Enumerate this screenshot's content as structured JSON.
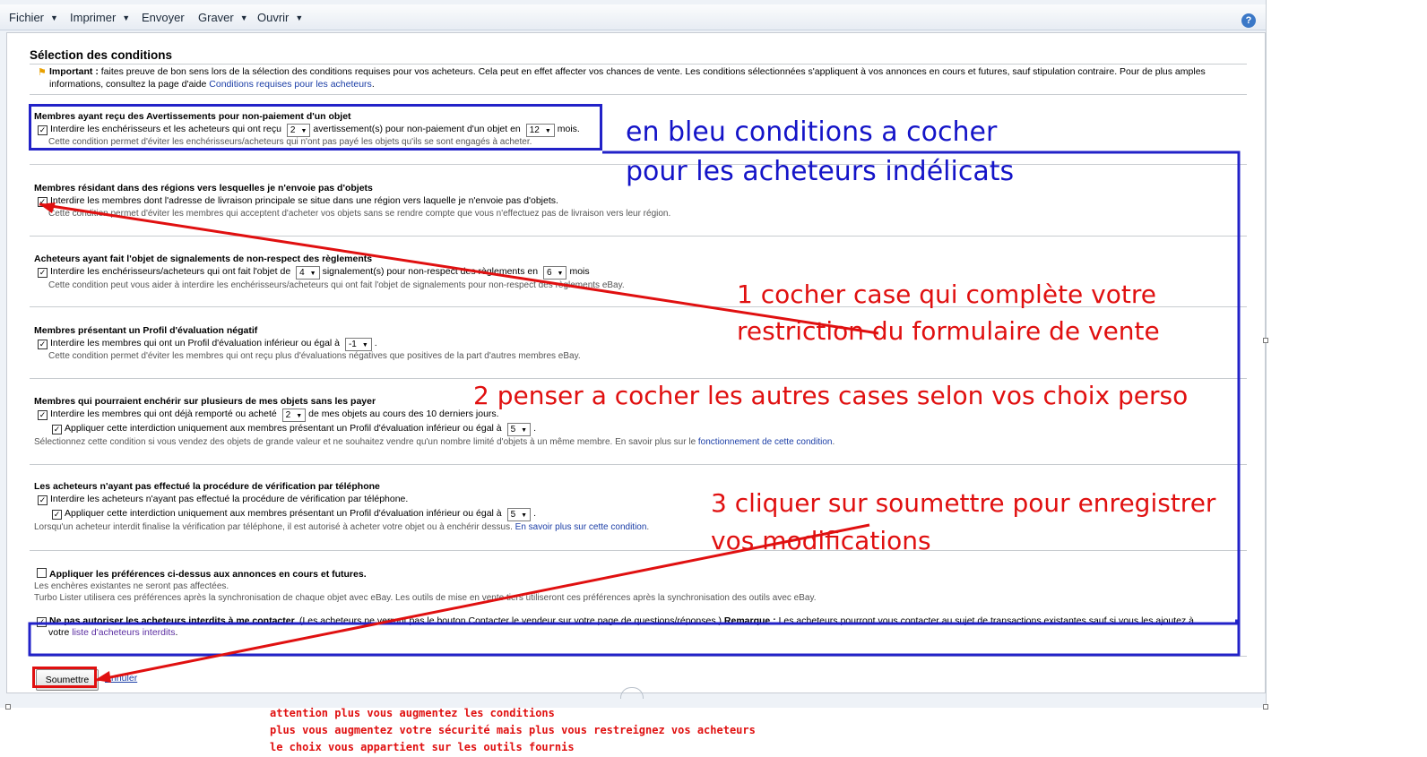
{
  "menu": [
    {
      "label": "Fichier",
      "has_dropdown": true
    },
    {
      "label": "Imprimer",
      "has_dropdown": true
    },
    {
      "label": "Envoyer",
      "has_dropdown": false
    },
    {
      "label": "Graver",
      "has_dropdown": true
    },
    {
      "label": "Ouvrir",
      "has_dropdown": true
    }
  ],
  "page": {
    "title": "Sélection des conditions",
    "important_bold": "Important :",
    "important_text": " faites preuve de bon sens lors de la sélection des conditions requises pour vos acheteurs. Cela peut en effet affecter vos chances de vente. Les conditions sélectionnées s'appliquent à vos annonces en cours et futures, sauf stipulation contraire. Pour de plus amples informations, consultez la page d'aide ",
    "important_link": "Conditions requises pour les acheteurs",
    "important_end": "."
  },
  "sections": {
    "s1": {
      "title": "Membres ayant reçu des Avertissements pour non-paiement d'un objet",
      "row_a": "Interdire les enchérisseurs et les acheteurs qui ont reçu",
      "select1": "2",
      "row_b": "avertissement(s) pour non-paiement d'un objet en",
      "select2": "12",
      "row_c": "mois.",
      "desc": "Cette condition permet d'éviter les enchérisseurs/acheteurs qui n'ont pas payé les objets qu'ils se sont engagés à acheter."
    },
    "s2": {
      "title": "Membres résidant dans des régions vers lesquelles je n'envoie pas d'objets",
      "row_a": "Interdire les membres dont l'adresse de livraison principale se situe dans une région vers laquelle je n'envoie pas d'objets.",
      "desc": "Cette condition permet d'éviter les membres qui acceptent d'acheter vos objets sans se rendre compte que vous n'effectuez pas de livraison vers leur région."
    },
    "s3": {
      "title": "Acheteurs ayant fait l'objet de signalements de non-respect des règlements",
      "row_a": "Interdire les enchérisseurs/acheteurs qui ont fait l'objet de",
      "select1": "4",
      "row_b": "signalement(s) pour non-respect des règlements en",
      "select2": "6",
      "row_c": "mois",
      "desc": "Cette condition peut vous aider à interdire les enchérisseurs/acheteurs qui ont fait l'objet de signalements pour non-respect des règlements eBay."
    },
    "s4": {
      "title": "Membres présentant un Profil d'évaluation négatif",
      "row_a": "Interdire les membres qui ont un Profil d'évaluation inférieur ou égal à",
      "select1": "-1",
      "row_end": ".",
      "desc": "Cette condition permet d'éviter les membres qui ont reçu plus d'évaluations négatives que positives de la part d'autres membres eBay."
    },
    "s5": {
      "title": "Membres qui pourraient enchérir sur plusieurs de mes objets sans les payer",
      "row_a": "Interdire les membres qui ont déjà remporté ou acheté",
      "select1": "2",
      "row_b": "de mes objets au cours des 10 derniers jours.",
      "row2": "Appliquer cette interdiction uniquement aux membres présentant un Profil d'évaluation inférieur ou égal à",
      "select2": "5",
      "row2_end": ".",
      "desc": "Sélectionnez cette condition si vous vendez des objets de grande valeur et ne souhaitez vendre qu'un nombre limité d'objets à un même membre. En savoir plus sur le ",
      "desc_link": "fonctionnement de cette condition",
      "desc_end": "."
    },
    "s6": {
      "title": "Les acheteurs n'ayant pas effectué la procédure de vérification par téléphone",
      "row_a": "Interdire les acheteurs n'ayant pas effectué la procédure de vérification par téléphone.",
      "row2": "Appliquer cette interdiction uniquement aux membres présentant un Profil d'évaluation inférieur ou égal à",
      "select2": "5",
      "row2_end": ".",
      "desc": "Lorsqu'un acheteur interdit finalise la vérification par téléphone, il est autorisé à acheter votre objet ou à enchérir dessus. ",
      "desc_link": "En savoir plus sur cette condition",
      "desc_end": "."
    },
    "s7": {
      "title": "Appliquer les préférences ci-dessus aux annonces en cours et futures.",
      "line1": "Les enchères existantes ne seront pas affectées.",
      "line2": "Turbo Lister utilisera ces préférences après la synchronisation de chaque objet avec eBay. Les outils de mise en vente tiers utiliseront ces préférences après la synchronisation des outils avec eBay."
    },
    "s8": {
      "bold": "Ne pas autoriser les acheteurs interdits à me contacter.",
      "text": " (Les acheteurs ne verront pas le bouton Contacter le vendeur sur votre page de questions/réponses.) ",
      "remark": "Remarque :",
      "text2": " Les acheteurs pourront vous contacter au sujet de transactions existantes sauf si vous les ajoutez à",
      "line2_a": "votre ",
      "line2_link": "liste d'acheteurs interdits",
      "line2_end": "."
    }
  },
  "buttons": {
    "submit": "Soumettre",
    "cancel": "Annuler"
  },
  "annotations": {
    "blue_line1": "en bleu conditions a cocher",
    "blue_line2": "pour les acheteurs indélicats",
    "red1_line1": "1 cocher case qui complète votre",
    "red1_line2": "restriction du formulaire de vente",
    "red2": "2 penser a cocher les autres cases selon vos choix perso",
    "red3_line1": "3 cliquer sur soumettre pour enregistrer",
    "red3_line2": "vos modifications",
    "note1": "attention plus vous augmentez les conditions",
    "note2": "plus vous augmentez votre sécurité mais plus vous restreignez vos acheteurs",
    "note3": "le choix vous appartient sur les outils fournis"
  },
  "colors": {
    "annotation_blue": "#1414c8",
    "annotation_red": "#e01010",
    "link": "#1a3da6"
  }
}
